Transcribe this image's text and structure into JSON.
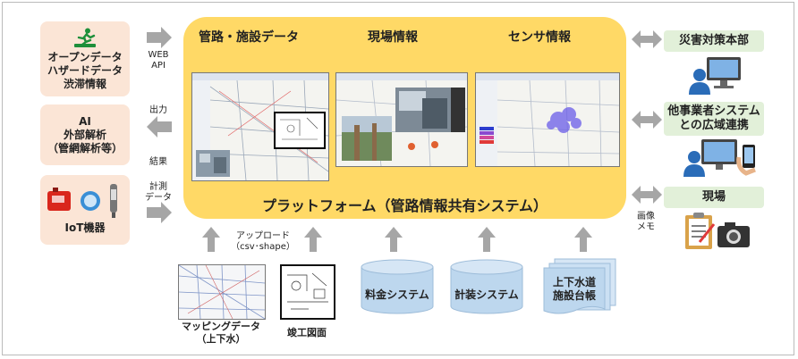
{
  "left_sources": [
    {
      "label": "オープンデータ\nハザードデータ\n渋滞情報",
      "icon": "running-person-icon"
    },
    {
      "label": "AI\n外部解析\n（管網解析等）",
      "icon": ""
    },
    {
      "label": "IoT機器",
      "icon": "iot-devices-icon"
    }
  ],
  "left_arrow_labels": {
    "web_api": "WEB\nAPI",
    "output": "出力",
    "result": "結果",
    "measurement": "計測\nデータ"
  },
  "platform": {
    "title": "プラットフォーム（管路情報共有システム）",
    "panels": [
      {
        "title": "管路・施設データ"
      },
      {
        "title": "現場情報"
      },
      {
        "title": "センサ情報"
      }
    ]
  },
  "right_targets": [
    {
      "label": "災害対策本部",
      "icon": "computer-user-icon"
    },
    {
      "label": "他事業者システム\nとの広域連携",
      "icon": "computer-phone-user-icon"
    },
    {
      "label": "現場",
      "icon": "clipboard-camera-icon"
    }
  ],
  "right_arrow_labels": {
    "image_memo": "画像\nメモ"
  },
  "upload_label": "アップロード\n（csv･shape）",
  "bottom_sources": [
    {
      "label": "マッピングデータ\n（上下水）"
    },
    {
      "label": "竣工図面"
    }
  ],
  "cylinders": [
    {
      "label": "料金システム"
    },
    {
      "label": "計装システム"
    }
  ],
  "ledger": {
    "label": "上下水道\n施設台帳"
  },
  "colors": {
    "platform": "#ffd966",
    "left_box": "#fbe5d6",
    "right_box": "#e2f0d9",
    "arrow": "#a6a6a6",
    "cylinder": "#bdd7ee"
  }
}
